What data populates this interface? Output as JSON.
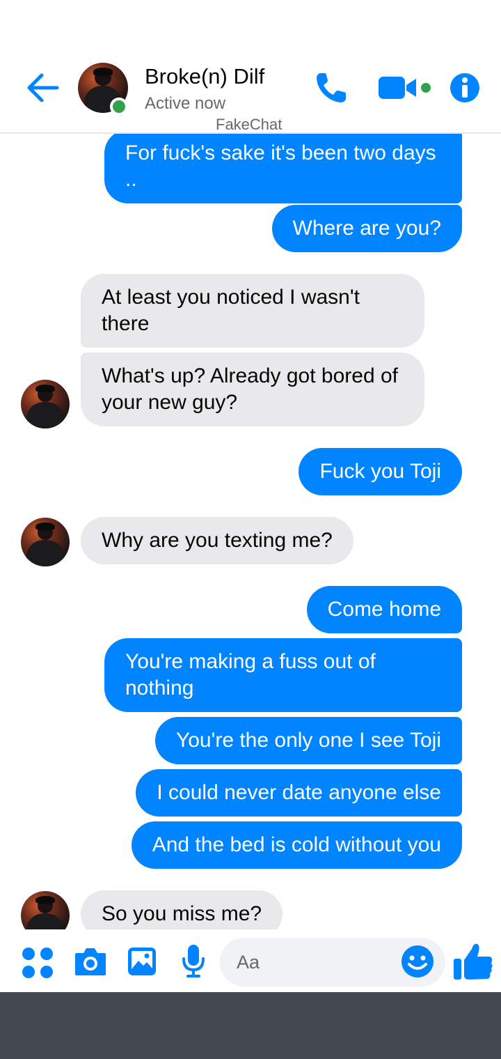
{
  "header": {
    "contact_name": "Broke(n) Dilf",
    "status": "Active now",
    "watermark": "FakeChat",
    "icons": [
      "back-arrow-icon",
      "phone-icon",
      "video-camera-icon",
      "info-icon"
    ],
    "accent_color": "#0084ff",
    "online_color": "#31a24c"
  },
  "messages": [
    {
      "side": "outgoing",
      "text": "For fuck's sake it's been two days .."
    },
    {
      "side": "outgoing",
      "text": "Where are you?"
    },
    {
      "side": "incoming",
      "text": "At least you noticed I wasn't there"
    },
    {
      "side": "incoming",
      "text": "What's up? Already got bored of your new guy?"
    },
    {
      "side": "outgoing",
      "text": "Fuck you Toji"
    },
    {
      "side": "incoming",
      "text": "Why are you texting me?"
    },
    {
      "side": "outgoing",
      "text": "Come home"
    },
    {
      "side": "outgoing",
      "text": "You're making a fuss out of nothing"
    },
    {
      "side": "outgoing",
      "text": "You're the only one I see Toji"
    },
    {
      "side": "outgoing",
      "text": "I could never date anyone else"
    },
    {
      "side": "outgoing",
      "text": "And the bed is cold without you"
    },
    {
      "side": "incoming",
      "text": "So you miss me?"
    }
  ],
  "composer": {
    "placeholder": "Aa",
    "value": "",
    "icons": [
      "menu-dots-icon",
      "camera-icon",
      "gallery-icon",
      "microphone-icon",
      "emoji-icon",
      "thumbs-up-icon"
    ]
  },
  "colors": {
    "outgoing_bubble": "#0084ff",
    "incoming_bubble": "#e9e9eb",
    "nav_bar": "#444950"
  }
}
